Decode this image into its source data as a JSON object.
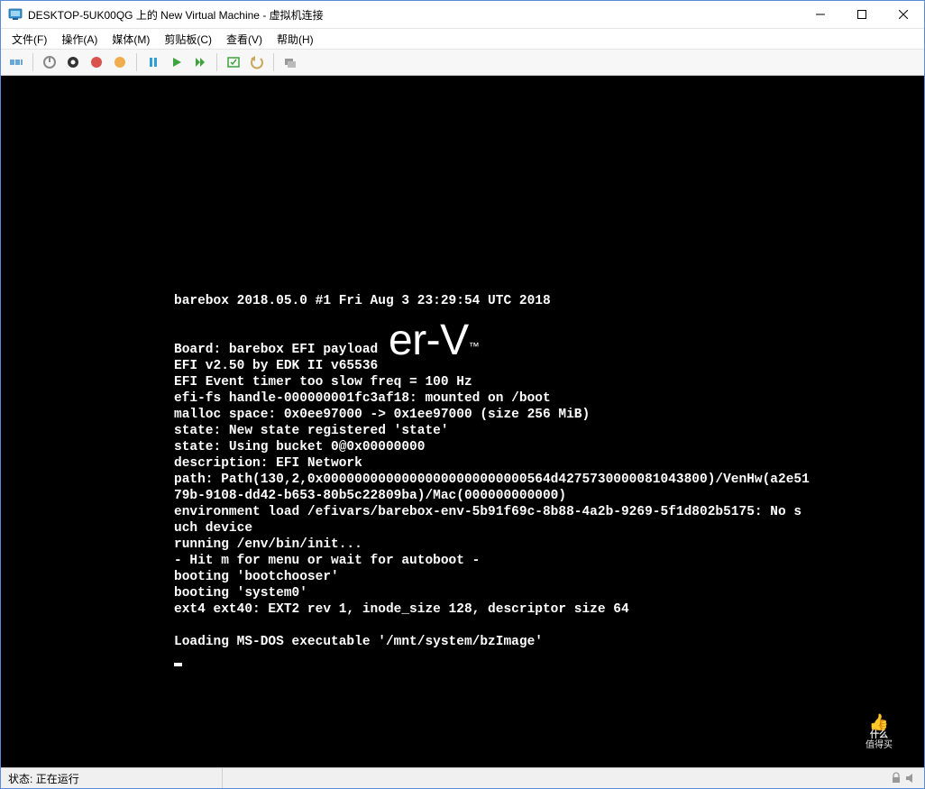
{
  "titlebar": {
    "title": "DESKTOP-5UK00QG 上的 New Virtual Machine - 虚拟机连接"
  },
  "menu": {
    "items": [
      "文件(F)",
      "操作(A)",
      "媒体(M)",
      "剪贴板(C)",
      "查看(V)",
      "帮助(H)"
    ]
  },
  "toolbar": {
    "icons": [
      "ctrl-alt-del",
      "power-off",
      "shutdown",
      "reset",
      "snapshot",
      "pause",
      "play",
      "play-fast",
      "checkpoint",
      "revert",
      "share"
    ]
  },
  "console": {
    "watermark_fragment": "er-V",
    "lines": [
      "barebox 2018.05.0 #1 Fri Aug 3 23:29:54 UTC 2018",
      "",
      "",
      "Board: barebox EFI payload",
      "EFI v2.50 by EDK II v65536",
      "EFI Event timer too slow freq = 100 Hz",
      "efi-fs handle-000000001fc3af18: mounted on /boot",
      "malloc space: 0x0ee97000 -> 0x1ee97000 (size 256 MiB)",
      "state: New state registered 'state'",
      "state: Using bucket 0@0x00000000",
      "description: EFI Network",
      "path: Path(130,2,0x00000000000000000000000000564d4275730000081043800)/VenHw(a2e51",
      "79b-9108-dd42-b653-80b5c22809ba)/Mac(000000000000)",
      "environment load /efivars/barebox-env-5b91f69c-8b88-4a2b-9269-5f1d802b5175: No s",
      "uch device",
      "running /env/bin/init...",
      "- Hit m for menu or wait for autoboot -",
      "booting 'bootchooser'",
      "booting 'system0'",
      "ext4 ext40: EXT2 rev 1, inode_size 128, descriptor size 64",
      "",
      "Loading MS-DOS executable '/mnt/system/bzImage'"
    ]
  },
  "statusbar": {
    "status_label": "状态:",
    "status_value": "正在运行"
  },
  "badge": {
    "line1": "什么",
    "line2": "值得买"
  }
}
